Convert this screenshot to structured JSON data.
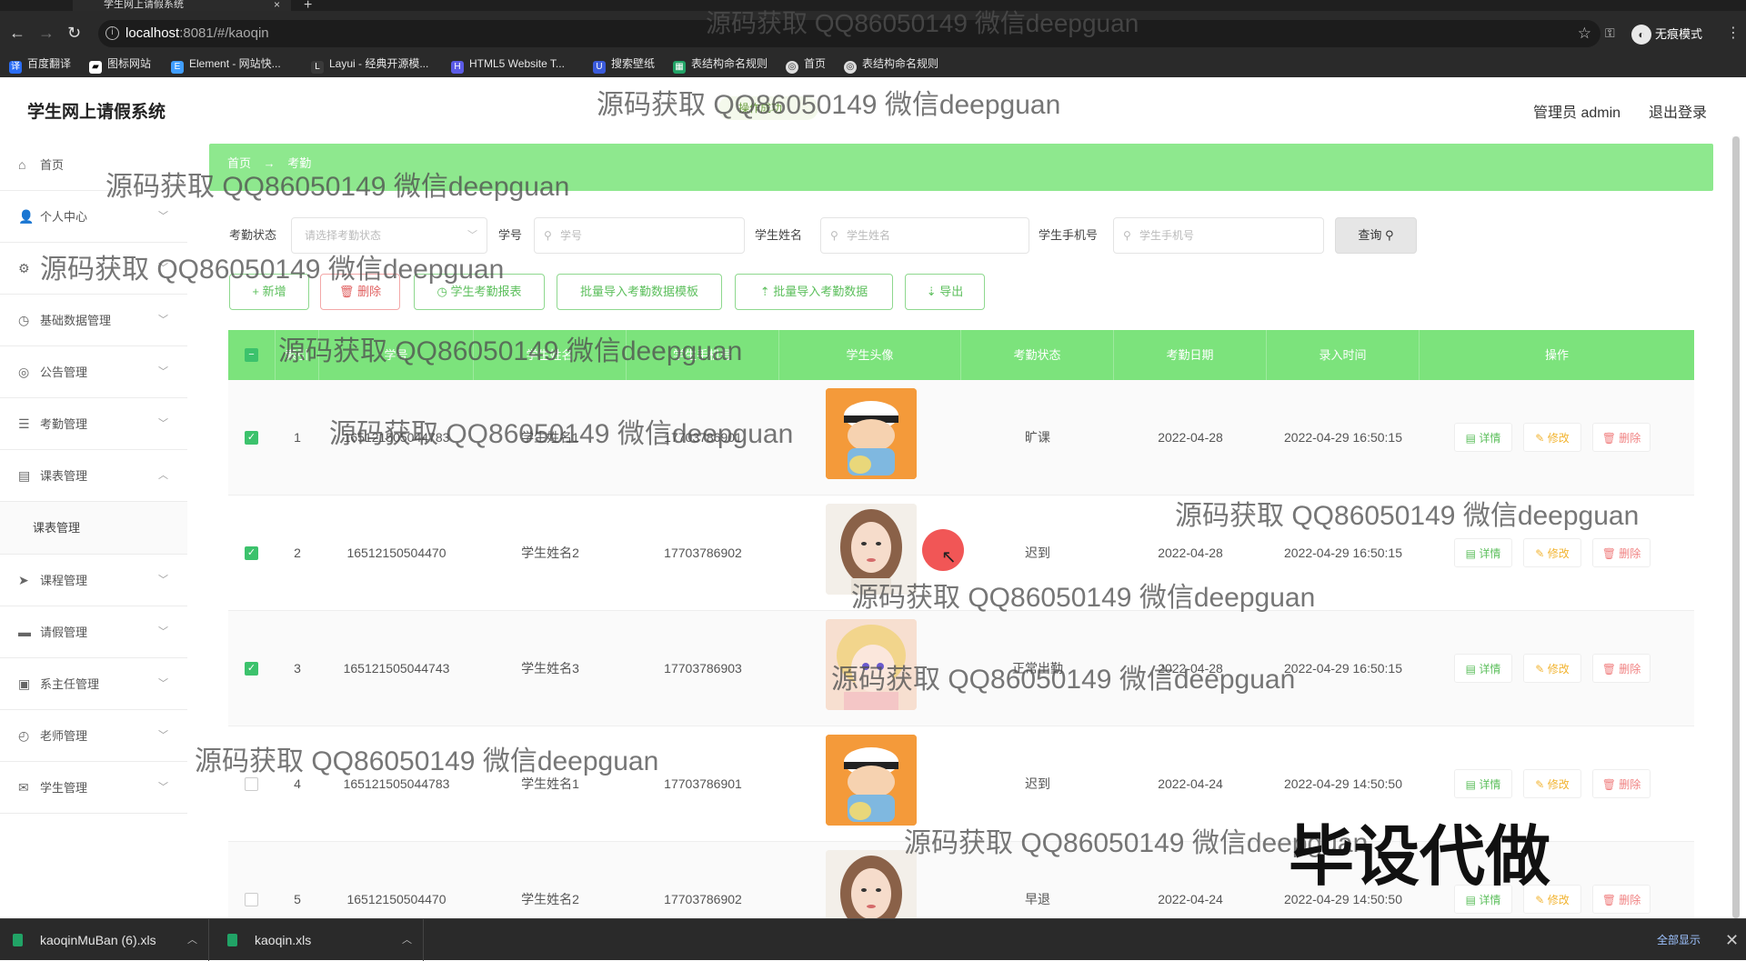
{
  "browser": {
    "tab_title": "学生网上请假系统",
    "new_tab": "+",
    "url_host": "localhost",
    "url_path": ":8081/#/kaoqin",
    "incognito_label": "无痕模式",
    "bookmarks": [
      "百度翻译",
      "图标网站",
      "Element - 网站快...",
      "Layui - 经典开源模...",
      "HTML5 Website T...",
      "搜索壁纸",
      "表结构命名规则",
      "首页",
      "表结构命名规则"
    ]
  },
  "header": {
    "app_title": "学生网上请假系统",
    "admin_label": "管理员 admin",
    "logout": "退出登录",
    "badge": "操作成功"
  },
  "sidebar": {
    "items": [
      {
        "label": "首页",
        "icon": "home-icon"
      },
      {
        "label": "个人中心",
        "icon": "user-icon"
      },
      {
        "label": "",
        "icon": "settings-icon"
      },
      {
        "label": "基础数据管理",
        "icon": "clock-icon"
      },
      {
        "label": "公告管理",
        "icon": "megaphone-icon"
      },
      {
        "label": "考勤管理",
        "icon": "list-icon"
      },
      {
        "label": "课表管理",
        "icon": "book-icon"
      },
      {
        "label": "课程管理",
        "icon": "send-icon"
      },
      {
        "label": "请假管理",
        "icon": "monitor-icon"
      },
      {
        "label": "系主任管理",
        "icon": "building-icon"
      },
      {
        "label": "老师管理",
        "icon": "compass-icon"
      },
      {
        "label": "学生管理",
        "icon": "mail-icon"
      }
    ],
    "sub_item": "课表管理"
  },
  "breadcrumb": {
    "home": "首页",
    "sep": "→",
    "current": "考勤"
  },
  "search": {
    "status_label": "考勤状态",
    "status_placeholder": "请选择考勤状态",
    "xuehao_label": "学号",
    "xuehao_placeholder": "学号",
    "name_label": "学生姓名",
    "name_placeholder": "学生姓名",
    "phone_label": "学生手机号",
    "phone_placeholder": "学生手机号",
    "query_button": "查询"
  },
  "actions": {
    "add": "+ 新增",
    "delete": "删除",
    "report": "学生考勤报表",
    "template": "批量导入考勤数据模板",
    "import": "批量导入考勤数据",
    "export": "导出"
  },
  "table": {
    "headers": [
      "",
      "索引",
      "学号",
      "学生姓名",
      "学生手机号",
      "学生头像",
      "考勤状态",
      "考勤日期",
      "录入时间",
      "操作"
    ],
    "ops": {
      "view": "详情",
      "edit": "修改",
      "del": "删除"
    },
    "rows": [
      {
        "idx": "1",
        "xuehao": "165121505044783",
        "name": "学生姓名1",
        "phone": "17703786901",
        "avatar": "boy",
        "status": "旷课",
        "date": "2022-04-28",
        "time": "2022-04-29 16:50:15",
        "checked": true
      },
      {
        "idx": "2",
        "xuehao": "16512150504470",
        "name": "学生姓名2",
        "phone": "17703786902",
        "avatar": "girl",
        "status": "迟到",
        "date": "2022-04-28",
        "time": "2022-04-29 16:50:15",
        "checked": true
      },
      {
        "idx": "3",
        "xuehao": "165121505044743",
        "name": "学生姓名3",
        "phone": "17703786903",
        "avatar": "anime",
        "status": "正常出勤",
        "date": "2022-04-28",
        "time": "2022-04-29 16:50:15",
        "checked": true
      },
      {
        "idx": "4",
        "xuehao": "165121505044783",
        "name": "学生姓名1",
        "phone": "17703786901",
        "avatar": "boy",
        "status": "迟到",
        "date": "2022-04-24",
        "time": "2022-04-29 14:50:50",
        "checked": false
      },
      {
        "idx": "5",
        "xuehao": "16512150504470",
        "name": "学生姓名2",
        "phone": "17703786902",
        "avatar": "girl",
        "status": "早退",
        "date": "2022-04-24",
        "time": "2022-04-29 14:50:50",
        "checked": false
      }
    ]
  },
  "watermark": "源码获取 QQ86050149 微信deepguan",
  "big_watermark": "毕设代做",
  "downloads": [
    {
      "name": "kaoqinMuBan (6).xls"
    },
    {
      "name": "kaoqin.xls"
    }
  ],
  "show_all": "全部显示",
  "colors": {
    "accent": "#7ce37c",
    "breadcrumb": "#8ee88e",
    "edit": "#f2b431",
    "danger": "#f08080"
  }
}
